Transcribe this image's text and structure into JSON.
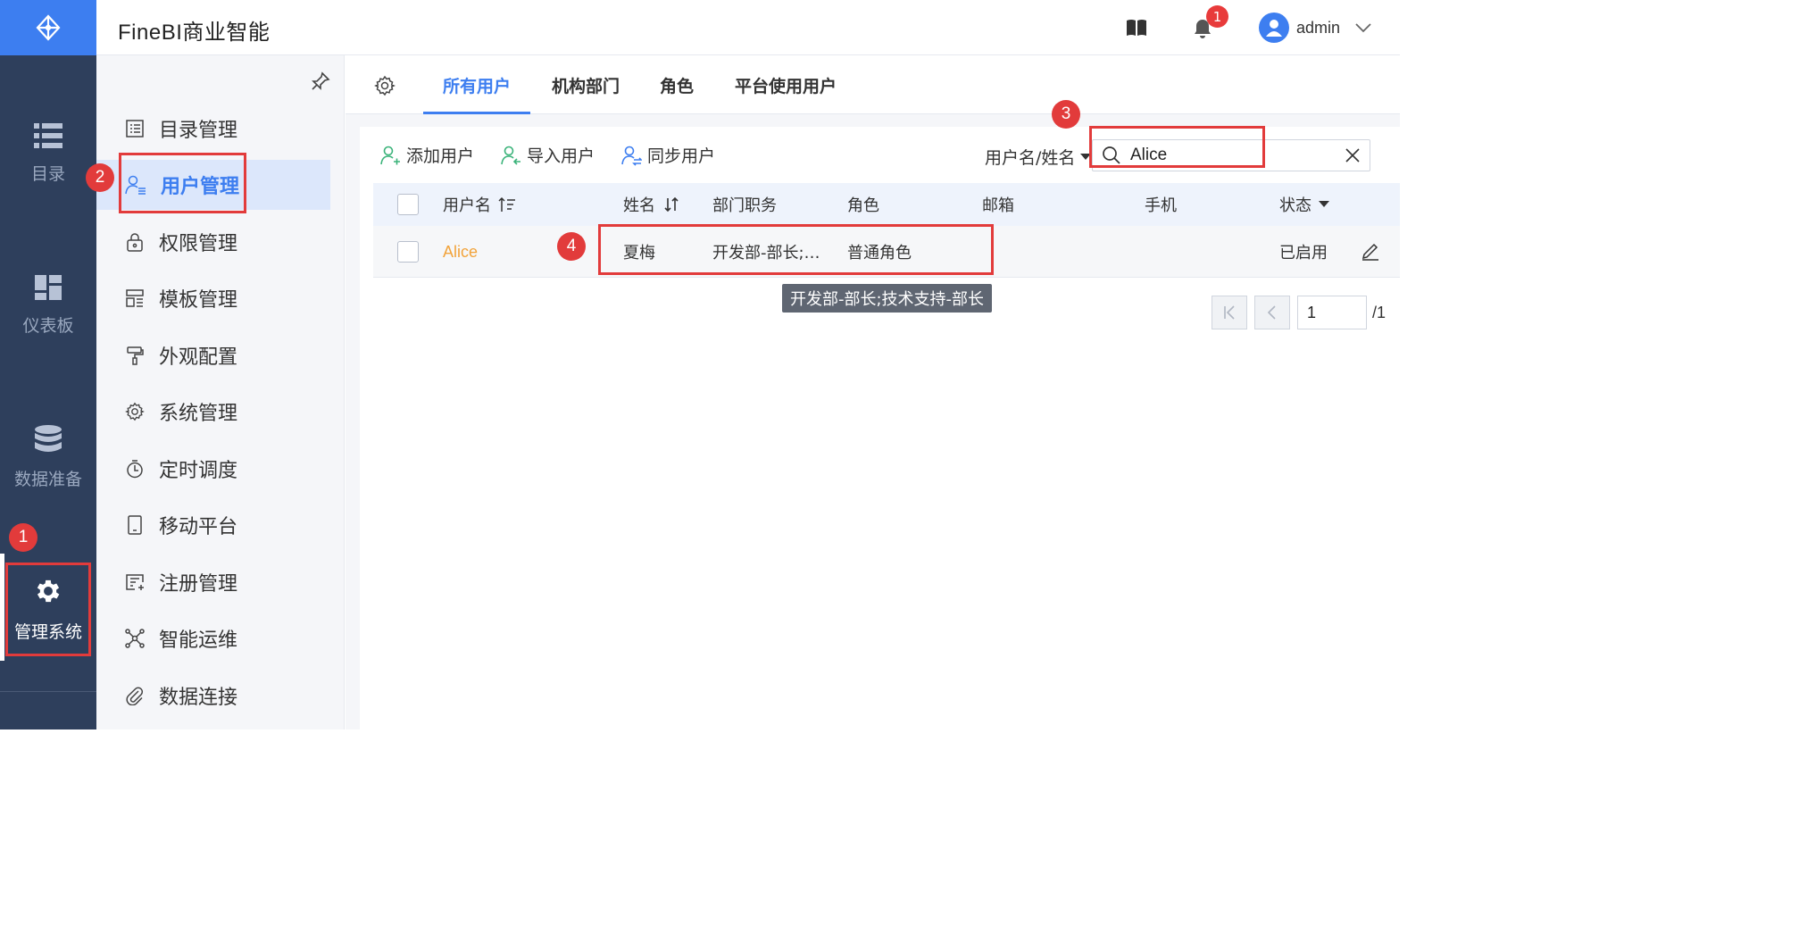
{
  "app": {
    "title": "FineBI商业智能"
  },
  "header": {
    "notification_count": "1",
    "user_name": "admin"
  },
  "rail": {
    "items": [
      {
        "label": "目录",
        "icon": "list-icon"
      },
      {
        "label": "仪表板",
        "icon": "dashboard-icon"
      },
      {
        "label": "数据准备",
        "icon": "database-icon"
      },
      {
        "label": "管理系统",
        "icon": "gear-icon",
        "active": true
      }
    ]
  },
  "menu": {
    "items": [
      {
        "label": "目录管理",
        "icon": "catalog-icon"
      },
      {
        "label": "用户管理",
        "icon": "user-manage-icon",
        "active": true
      },
      {
        "label": "权限管理",
        "icon": "lock-icon"
      },
      {
        "label": "模板管理",
        "icon": "template-icon"
      },
      {
        "label": "外观配置",
        "icon": "paint-roller-icon"
      },
      {
        "label": "系统管理",
        "icon": "gear-icon"
      },
      {
        "label": "定时调度",
        "icon": "timer-icon"
      },
      {
        "label": "移动平台",
        "icon": "tablet-icon"
      },
      {
        "label": "注册管理",
        "icon": "register-icon"
      },
      {
        "label": "智能运维",
        "icon": "network-icon"
      },
      {
        "label": "数据连接",
        "icon": "paperclip-icon"
      }
    ]
  },
  "tabs": [
    {
      "label": "所有用户",
      "active": true
    },
    {
      "label": "机构部门"
    },
    {
      "label": "角色"
    },
    {
      "label": "平台使用用户"
    }
  ],
  "toolbar": {
    "add_user": "添加用户",
    "import_user": "导入用户",
    "sync_user": "同步用户",
    "search_type": "用户名/姓名",
    "search_value": "Alice"
  },
  "table": {
    "headers": {
      "username": "用户名",
      "name": "姓名",
      "department": "部门职务",
      "role": "角色",
      "email": "邮箱",
      "phone": "手机",
      "status": "状态"
    },
    "rows": [
      {
        "username": "Alice",
        "name": "夏梅",
        "department": "开发部-部长;…",
        "role": "普通角色",
        "email": "",
        "phone": "",
        "status": "已启用"
      }
    ]
  },
  "tooltip": {
    "text": "开发部-部长;技术支持-部长"
  },
  "pagination": {
    "current_page": "1",
    "total_label": "/1"
  },
  "annotations": [
    "1",
    "2",
    "3",
    "4"
  ],
  "colors": {
    "accent": "#3d7ef0",
    "rail_bg": "#2e3f5c",
    "highlight": "#e23b3b",
    "username": "#f2a33a"
  }
}
